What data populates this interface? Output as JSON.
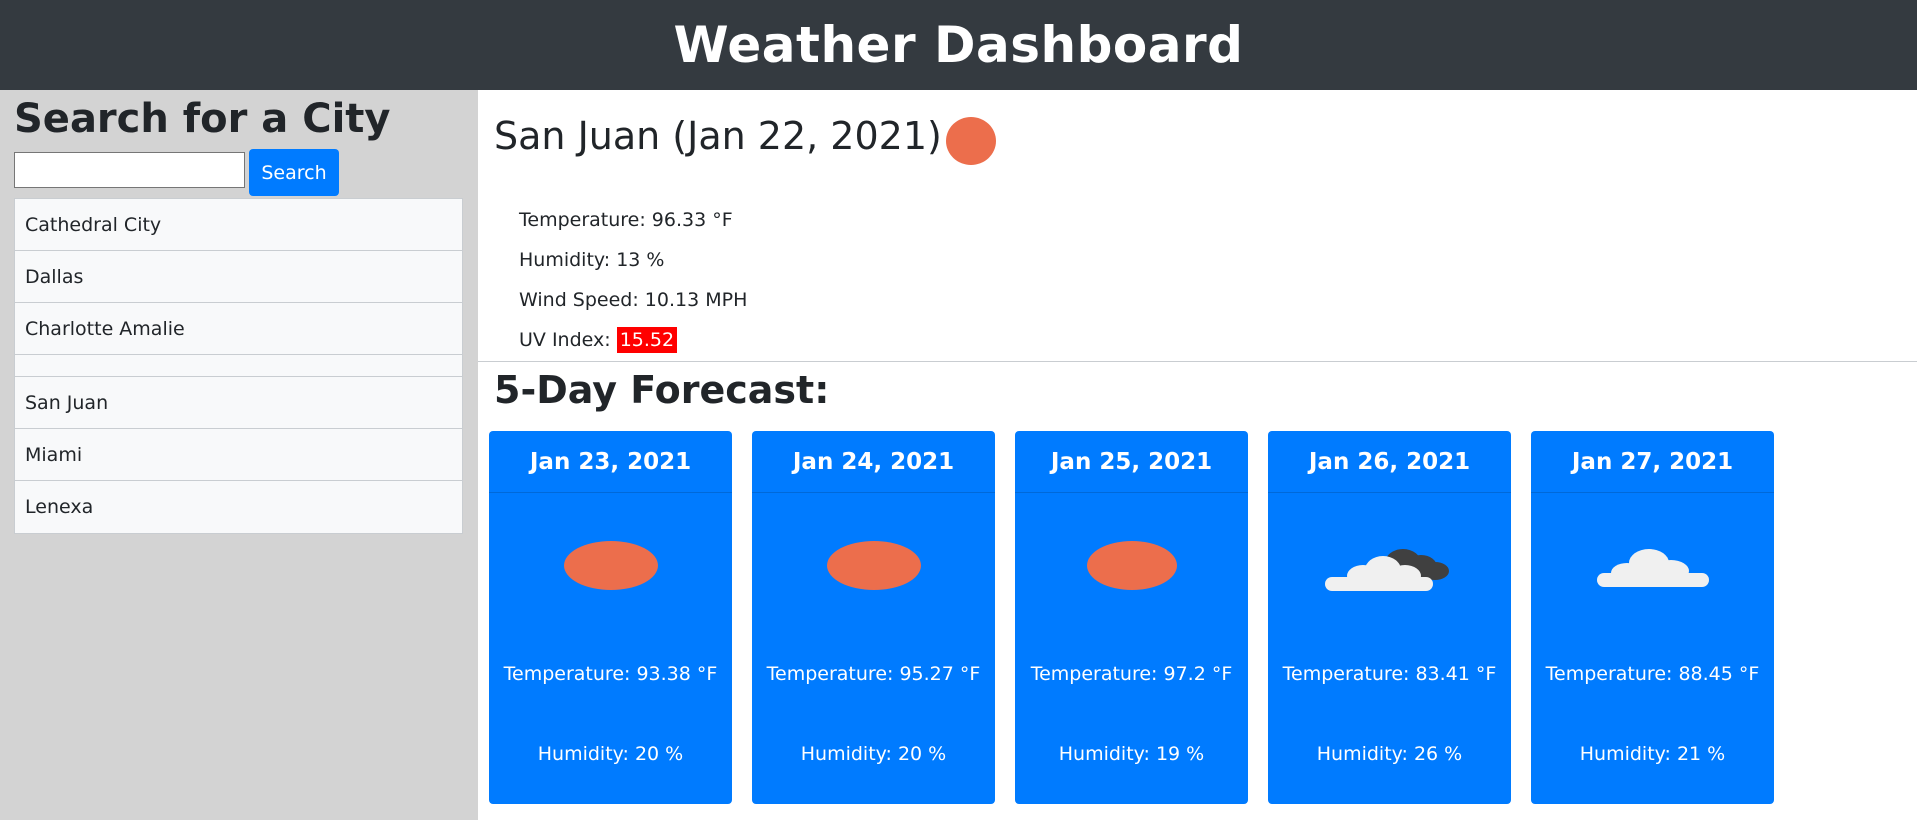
{
  "header": {
    "title": "Weather Dashboard"
  },
  "sidebar": {
    "heading": "Search for a City",
    "search": {
      "value": "",
      "placeholder": "",
      "button_label": "Search"
    },
    "cities": [
      "Cathedral City",
      "Dallas",
      "Charlotte Amalie",
      "",
      "San Juan",
      "Miami",
      "Lenexa"
    ]
  },
  "current": {
    "title": "San Juan (Jan 22, 2021)",
    "icon": "sun-icon",
    "temperature_label": "Temperature: 96.33 °F",
    "humidity_label": "Humidity: 13 %",
    "wind_label": "Wind Speed: 10.13 MPH",
    "uv_label": "UV Index:",
    "uv_value": "15.52",
    "uv_color": "#ff0000"
  },
  "forecast": {
    "title": "5-Day Forecast:",
    "days": [
      {
        "date": "Jan 23, 2021",
        "icon": "sun-icon",
        "temperature": "Temperature: 93.38 °F",
        "humidity": "Humidity: 20 %"
      },
      {
        "date": "Jan 24, 2021",
        "icon": "sun-icon",
        "temperature": "Temperature: 95.27 °F",
        "humidity": "Humidity: 20 %"
      },
      {
        "date": "Jan 25, 2021",
        "icon": "sun-icon",
        "temperature": "Temperature: 97.2 °F",
        "humidity": "Humidity: 19 %"
      },
      {
        "date": "Jan 26, 2021",
        "icon": "broken-clouds-icon",
        "temperature": "Temperature: 83.41 °F",
        "humidity": "Humidity: 26 %"
      },
      {
        "date": "Jan 27, 2021",
        "icon": "cloud-icon",
        "temperature": "Temperature: 88.45 °F",
        "humidity": "Humidity: 21 %"
      }
    ]
  },
  "colors": {
    "accent": "#007bff",
    "header_bg": "#343a40",
    "sidebar_bg": "#d3d3d3",
    "sun": "#ec6e4c"
  }
}
